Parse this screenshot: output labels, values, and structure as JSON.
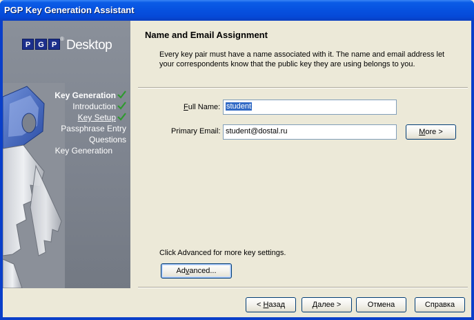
{
  "window": {
    "title": "PGP Key Generation Assistant"
  },
  "branding": {
    "logo_letters": [
      "P",
      "G",
      "P"
    ],
    "registered_mark": "®",
    "product": "Desktop"
  },
  "sidebar": {
    "steps": [
      {
        "label": "Key Generation",
        "checked": true,
        "bold": true,
        "link": false
      },
      {
        "label": "Introduction",
        "checked": true,
        "bold": false,
        "link": false
      },
      {
        "label": "Key Setup",
        "checked": true,
        "bold": false,
        "link": true
      },
      {
        "label": "Passphrase Entry",
        "checked": false,
        "bold": false,
        "link": false
      },
      {
        "label": "Questions",
        "checked": false,
        "bold": false,
        "link": false
      },
      {
        "label": "Key Generation",
        "checked": false,
        "bold": false,
        "link": false
      }
    ]
  },
  "header": {
    "title": "Name and Email Assignment",
    "description": "Every key pair must have a name associated with it.  The name and email address let your correspondents know that the public key they are using belongs to you."
  },
  "form": {
    "full_name": {
      "label_prefix": "F",
      "label_rest": "ull Name:",
      "value": "student"
    },
    "primary_email": {
      "label": "Primary Email:",
      "value": "student@dostal.ru"
    },
    "more_button": {
      "label_prefix": "M",
      "label_rest": "ore >"
    }
  },
  "advanced": {
    "hint": "Click Advanced for more key settings.",
    "button": {
      "label_prefix": "Ad",
      "label_u": "v",
      "label_rest": "anced..."
    }
  },
  "footer": {
    "back": {
      "prefix": "< ",
      "u": "Н",
      "rest": "азад"
    },
    "next": {
      "prefix": "",
      "u": "Д",
      "rest": "алее >"
    },
    "cancel": {
      "label": "Отмена"
    },
    "help": {
      "label": "Справка"
    }
  },
  "colors": {
    "titlebar": "#0752e0",
    "sidebar": "#7c828d",
    "selection": "#316ac5",
    "check": "#2e9a2e"
  }
}
